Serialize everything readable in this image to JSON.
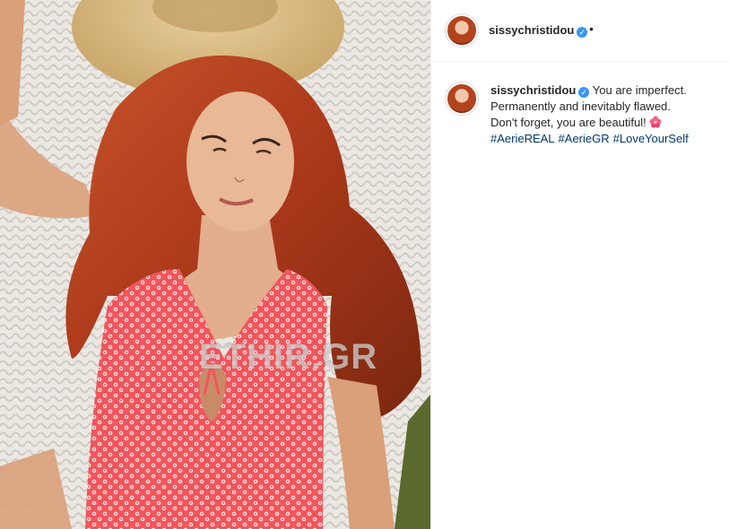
{
  "post": {
    "username": "sissychristidou",
    "header_dot": "•",
    "caption_lines": [
      "You are imperfect.",
      "Permanently and inevitably flawed.",
      "Don't forget, you are beautiful!"
    ],
    "hashtags": [
      "#AerieREAL",
      "#AerieGR",
      "#LoveYourSelf"
    ],
    "watermark": "ETHIR.GR",
    "icons": {
      "verified": "verified-badge-icon",
      "emoji": "hibiscus-flower-icon"
    },
    "colors": {
      "accent_blue": "#3897f0",
      "hashtag": "#00376b",
      "swimsuit": "#f2555b",
      "hair": "#a9381a"
    }
  }
}
